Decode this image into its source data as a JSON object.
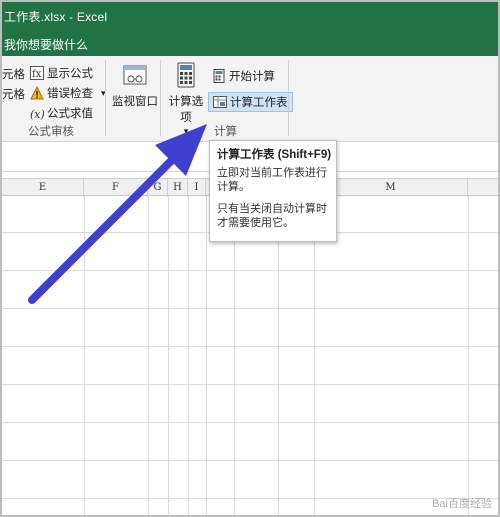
{
  "window": {
    "title": "工作表.xlsx  -  Excel",
    "tell_me": "我你想要做什么"
  },
  "ribbon": {
    "left_items": {
      "cell_top": "元格",
      "cell_mid": "元格"
    },
    "audit": {
      "show_formulas": "显示公式",
      "error_check": "错误检查",
      "error_check_arrow": "▾",
      "evaluate_formula": "公式求值",
      "group_label": "公式审核"
    },
    "watch_window": "监视窗口",
    "calc": {
      "options_label": "计算选项",
      "options_arrow": "▾",
      "calc_now": "开始计算",
      "calc_sheet": "计算工作表",
      "group_label": "计算"
    }
  },
  "columns": [
    "E",
    "F",
    "G",
    "H",
    "I",
    "M"
  ],
  "tooltip": {
    "title": "计算工作表 (Shift+F9)",
    "line1": "立即对当前工作表进行计算。",
    "line2": "只有当关闭自动计算时才需要使用它。"
  },
  "watermark": "Bai百度经验",
  "colors": {
    "excel_green": "#217346",
    "arrow_blue": "#3f3fd0",
    "highlight": "#cfe3f7"
  }
}
